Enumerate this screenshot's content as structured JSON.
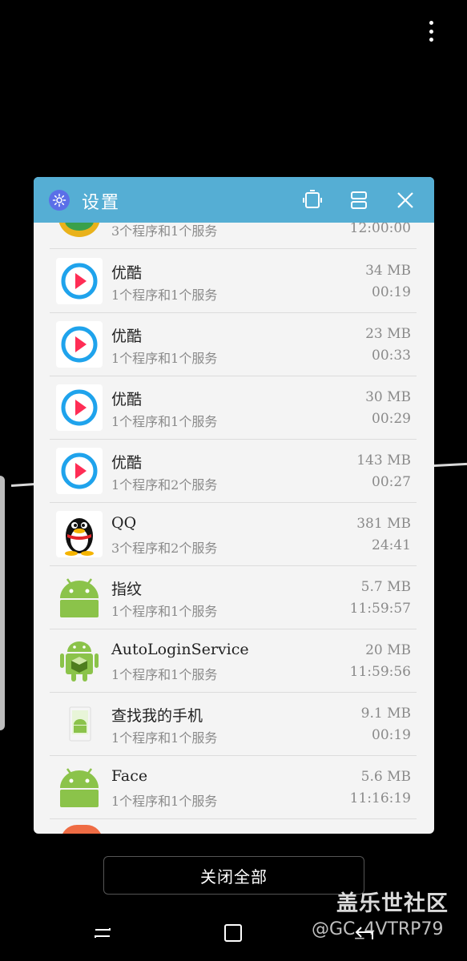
{
  "popup": {
    "title": "设置",
    "icons": [
      "gear-icon",
      "rotate-icon",
      "split-view-icon",
      "close-icon"
    ]
  },
  "apps": [
    {
      "name": "",
      "sub": "3个程序和1个服务",
      "mem": "",
      "time": "12:00:00",
      "icon": "partial-app-icon"
    },
    {
      "name": "优酷",
      "sub": "1个程序和1个服务",
      "mem": "34 MB",
      "time": "00:19",
      "icon": "youku-icon"
    },
    {
      "name": "优酷",
      "sub": "1个程序和1个服务",
      "mem": "23 MB",
      "time": "00:33",
      "icon": "youku-icon"
    },
    {
      "name": "优酷",
      "sub": "1个程序和1个服务",
      "mem": "30 MB",
      "time": "00:29",
      "icon": "youku-icon"
    },
    {
      "name": "优酷",
      "sub": "1个程序和2个服务",
      "mem": "143 MB",
      "time": "00:27",
      "icon": "youku-icon"
    },
    {
      "name": "QQ",
      "sub": "3个程序和2个服务",
      "mem": "381 MB",
      "time": "24:41",
      "icon": "qq-penguin-icon"
    },
    {
      "name": "指纹",
      "sub": "1个程序和1个服务",
      "mem": "5.7 MB",
      "time": "11:59:57",
      "icon": "android-icon"
    },
    {
      "name": "AutoLoginService",
      "sub": "1个程序和1个服务",
      "mem": "20 MB",
      "time": "11:59:56",
      "icon": "android-box-icon"
    },
    {
      "name": "查找我的手机",
      "sub": "1个程序和1个服务",
      "mem": "9.1 MB",
      "time": "00:19",
      "icon": "find-phone-icon"
    },
    {
      "name": "Face",
      "sub": "1个程序和1个服务",
      "mem": "5.6 MB",
      "time": "11:16:19",
      "icon": "android-icon"
    }
  ],
  "close_all_label": "关闭全部",
  "watermark": {
    "main": "盖乐世社区",
    "sub": "@GC_4VTRP79"
  },
  "nav": [
    "recents-icon",
    "home-icon",
    "back-icon"
  ],
  "colors": {
    "titlebar": "#55aed4",
    "background": "#000000",
    "popup": "#f4f4f4"
  }
}
